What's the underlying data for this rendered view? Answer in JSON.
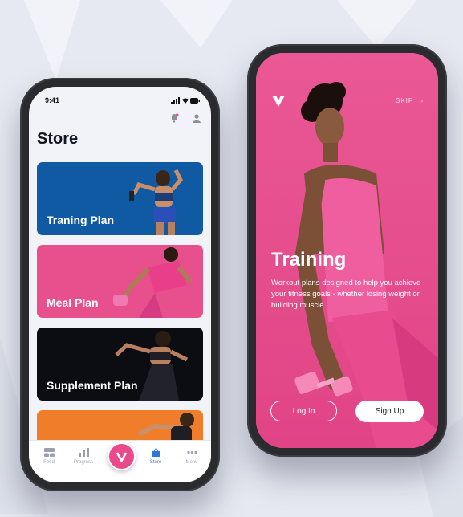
{
  "colors": {
    "background": "#e6e9f1",
    "brand_pink": "#e8508d",
    "training_card": "#0f5aa3",
    "meal_card": "#e8508d",
    "supplement_card": "#0c0d12",
    "orange_card": "#ef7d2a",
    "tab_active": "#2f79d6"
  },
  "left_phone": {
    "status_time": "9:41",
    "icons": [
      "notification-bell-icon",
      "profile-icon"
    ],
    "title": "Store",
    "cards": [
      {
        "label": "Traning Plan"
      },
      {
        "label": "Meal Plan"
      },
      {
        "label": "Supplement Plan"
      },
      {
        "label": ""
      }
    ],
    "tabs": [
      {
        "label": "Feed",
        "icon": "feed-icon"
      },
      {
        "label": "Progress",
        "icon": "progress-chart-icon"
      },
      {
        "label": "Store",
        "icon": "store-bag-icon",
        "active": true
      },
      {
        "label": "Menu",
        "icon": "menu-dots-icon"
      }
    ],
    "center_button_letter": "V"
  },
  "right_phone": {
    "skip_label": "SKIP",
    "title": "Training",
    "description": "Workout plans designed to help you achieve your fitness goals - whether losing weight or building muscle",
    "login_label": "Log In",
    "signup_label": "Sign Up"
  }
}
